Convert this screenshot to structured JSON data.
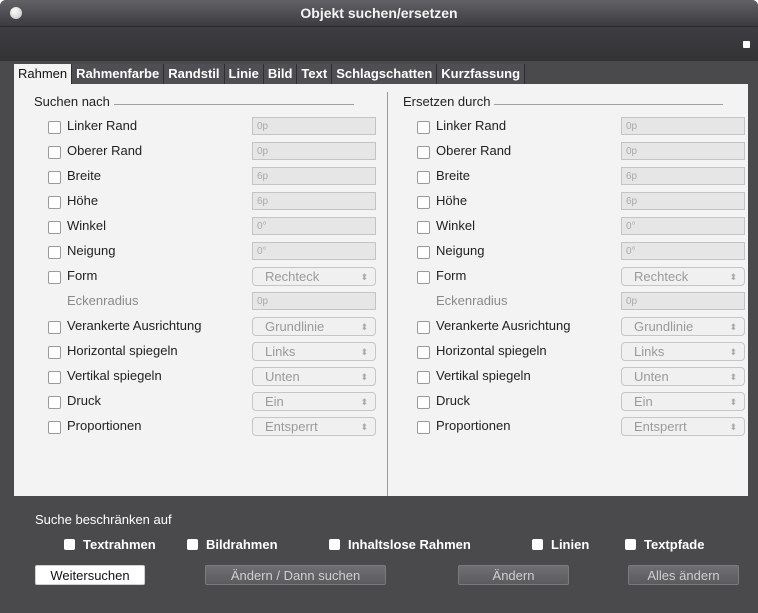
{
  "window": {
    "title": "Objekt suchen/ersetzen"
  },
  "tabs": [
    {
      "label": "Rahmen",
      "active": true
    },
    {
      "label": "Rahmenfarbe"
    },
    {
      "label": "Randstil"
    },
    {
      "label": "Linie"
    },
    {
      "label": "Bild"
    },
    {
      "label": "Text"
    },
    {
      "label": "Schlagschatten"
    },
    {
      "label": "Kurzfassung"
    }
  ],
  "search": {
    "title": "Suchen nach",
    "rows": [
      {
        "label": "Linker Rand",
        "value": "0p"
      },
      {
        "label": "Oberer Rand",
        "value": "0p"
      },
      {
        "label": "Breite",
        "value": "6p"
      },
      {
        "label": "Höhe",
        "value": "6p"
      },
      {
        "label": "Winkel",
        "value": "0°"
      },
      {
        "label": "Neigung",
        "value": "0°"
      },
      {
        "label": "Form",
        "value": "Rechteck"
      },
      {
        "label": "Eckenradius",
        "value": "0p"
      },
      {
        "label": "Verankerte Ausrichtung",
        "value": "Grundlinie"
      },
      {
        "label": "Horizontal spiegeln",
        "value": "Links"
      },
      {
        "label": "Vertikal spiegeln",
        "value": "Unten"
      },
      {
        "label": "Druck",
        "value": "Ein"
      },
      {
        "label": "Proportionen",
        "value": "Entsperrt"
      }
    ]
  },
  "replace": {
    "title": "Ersetzen durch",
    "rows": [
      {
        "label": "Linker Rand",
        "value": "0p"
      },
      {
        "label": "Oberer Rand",
        "value": "0p"
      },
      {
        "label": "Breite",
        "value": "6p"
      },
      {
        "label": "Höhe",
        "value": "6p"
      },
      {
        "label": "Winkel",
        "value": "0°"
      },
      {
        "label": "Neigung",
        "value": "0°"
      },
      {
        "label": "Form",
        "value": "Rechteck"
      },
      {
        "label": "Eckenradius",
        "value": "0p"
      },
      {
        "label": "Verankerte Ausrichtung",
        "value": "Grundlinie"
      },
      {
        "label": "Horizontal spiegeln",
        "value": "Links"
      },
      {
        "label": "Vertikal spiegeln",
        "value": "Unten"
      },
      {
        "label": "Druck",
        "value": "Ein"
      },
      {
        "label": "Proportionen",
        "value": "Entsperrt"
      }
    ]
  },
  "limit": {
    "title": "Suche beschränken auf",
    "options": [
      "Textrahmen",
      "Bildrahmen",
      "Inhaltslose Rahmen",
      "Linien",
      "Textpfade"
    ]
  },
  "buttons": {
    "find_next": "Weitersuchen",
    "change_then_find": "Ändern / Dann suchen",
    "change": "Ändern",
    "change_all": "Alles ändern"
  }
}
